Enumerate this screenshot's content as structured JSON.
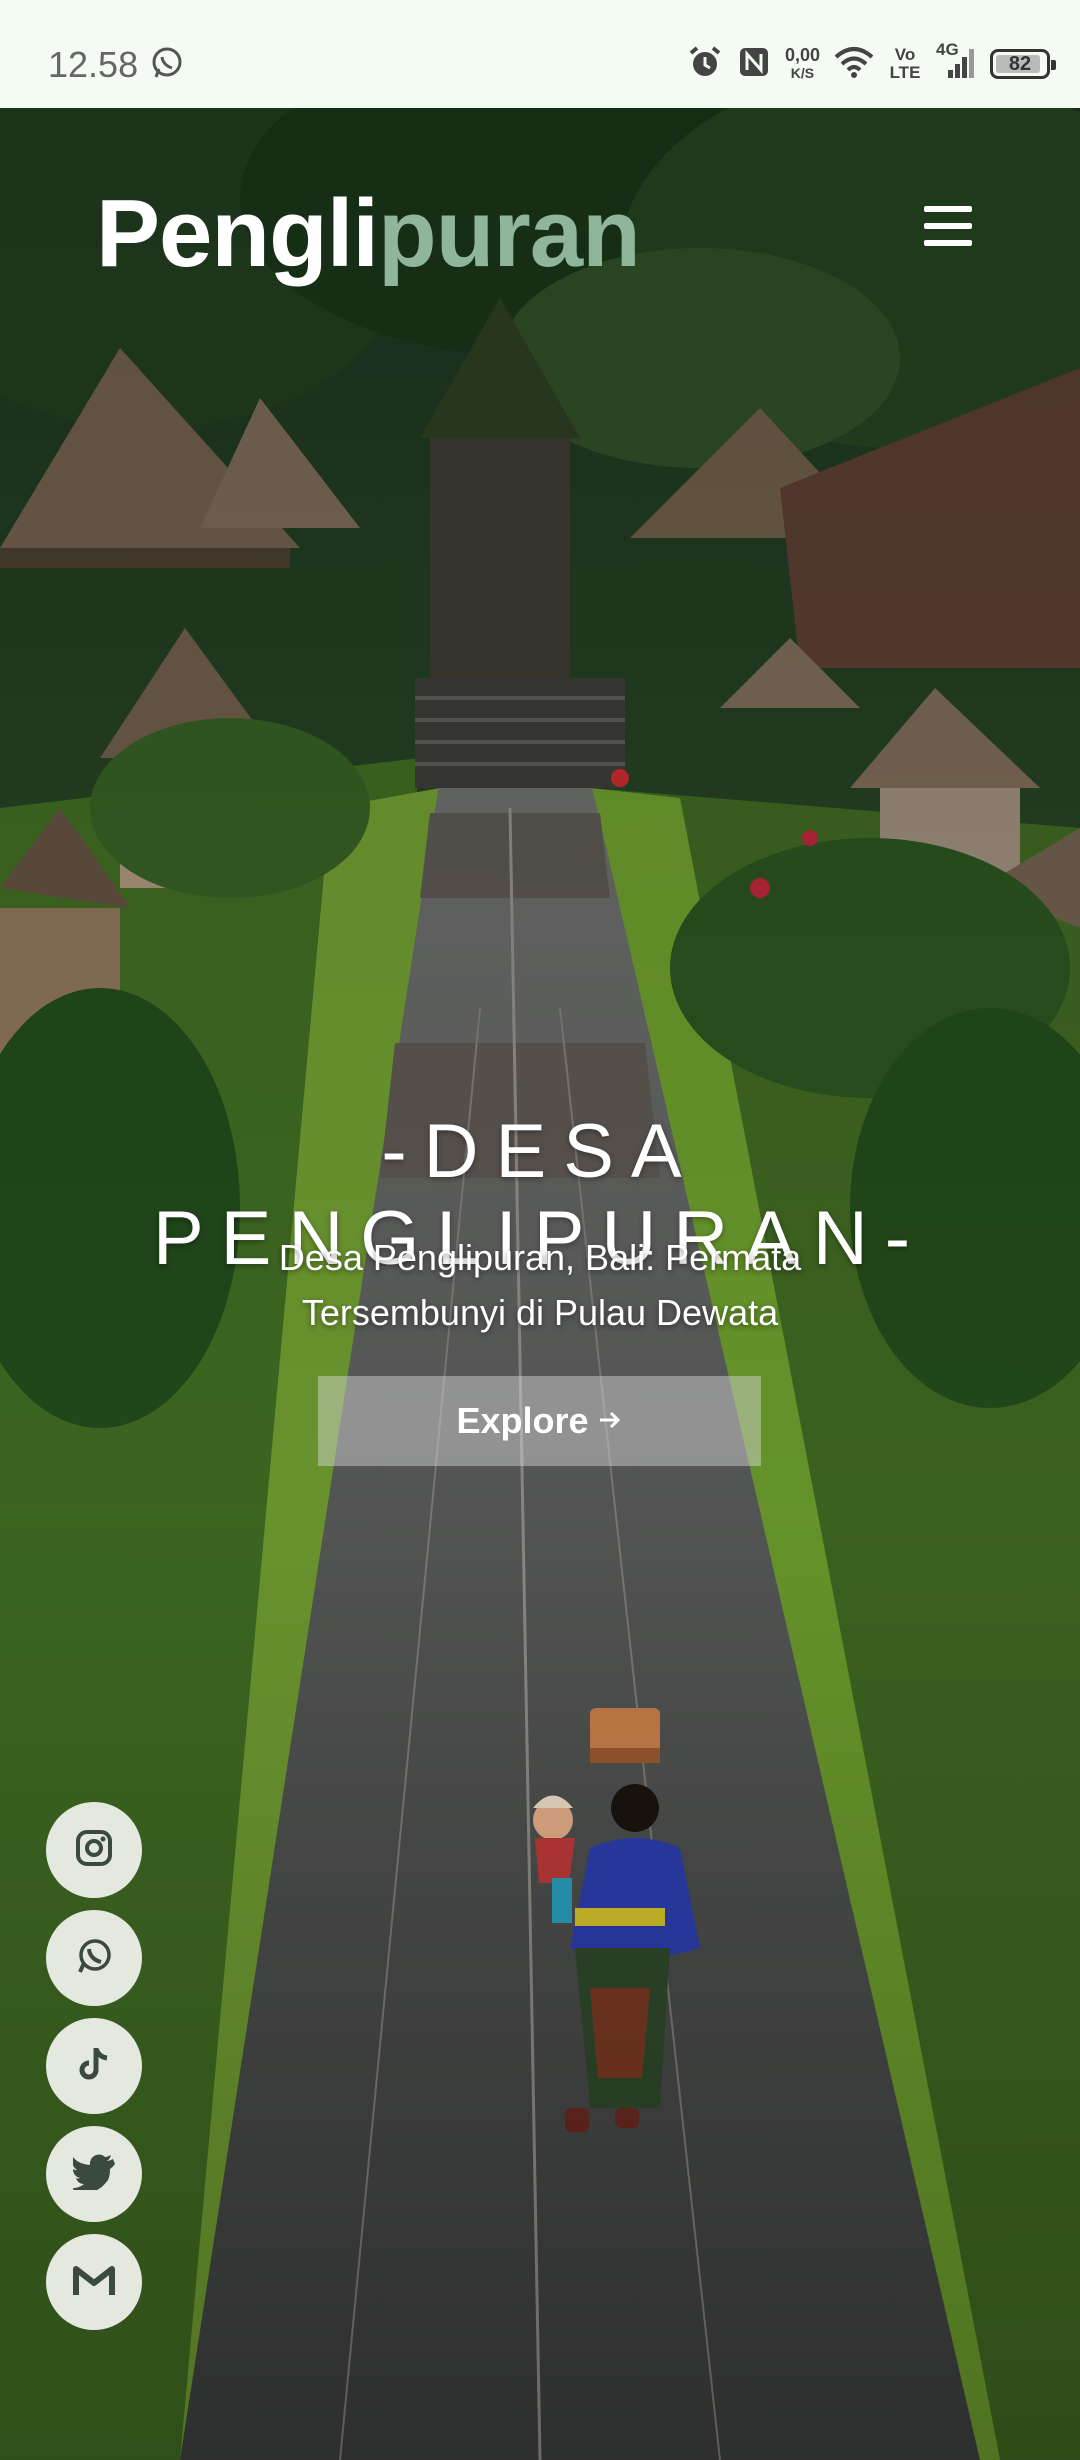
{
  "status_bar": {
    "time": "12.58",
    "net_speed": "0,00",
    "net_unit": "K/S",
    "volte": "Vo LTE",
    "network": "4G",
    "battery": "82",
    "icons": [
      "whatsapp-icon",
      "alarm-icon",
      "nfc-icon",
      "wifi-icon",
      "signal-icon",
      "battery-icon"
    ]
  },
  "header": {
    "brand_part1": "Pengli",
    "brand_part2": "puran",
    "menu_icon": "hamburger-menu-icon"
  },
  "hero": {
    "headline": "-DESA PENGLIPURAN-",
    "subtitle": "Desa Penglipuran, Bali: Permata Tersembunyi di Pulau Dewata",
    "explore_label": "Explore",
    "explore_icon": "arrow-right-icon"
  },
  "social_links": [
    {
      "icon": "instagram-icon"
    },
    {
      "icon": "whatsapp-icon"
    },
    {
      "icon": "tiktok-icon"
    },
    {
      "icon": "twitter-icon"
    },
    {
      "icon": "gmail-icon"
    }
  ],
  "colors": {
    "status_bg": "#f3fbf3",
    "brand_accent": "#8fb59a",
    "social_bg": "#e5e8df",
    "social_icon": "#3a4a3c"
  }
}
